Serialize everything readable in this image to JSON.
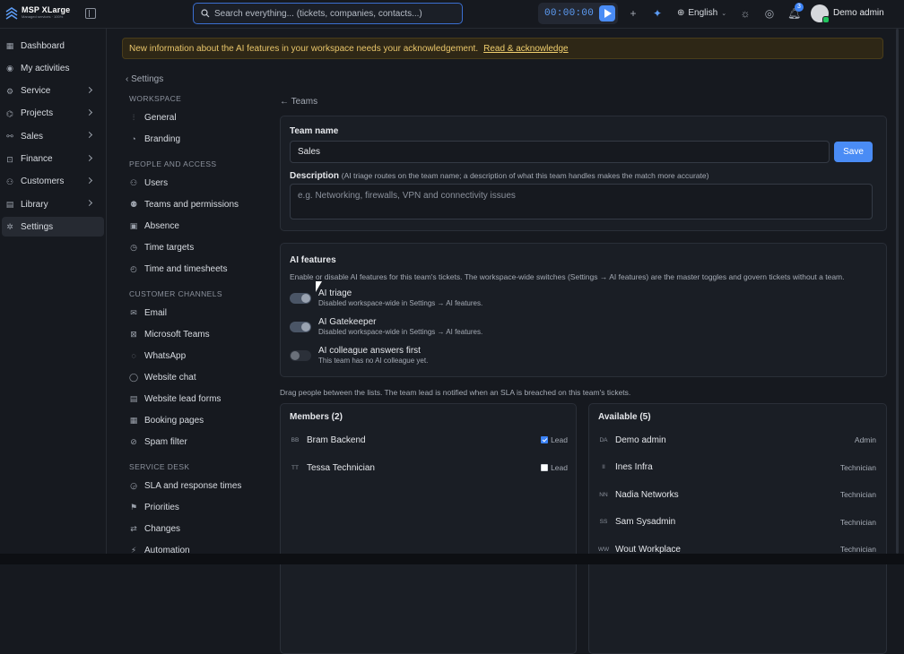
{
  "app": {
    "name": "MSP XLarge",
    "tagline": "Managed services · 100%"
  },
  "search": {
    "placeholder": "Search everything... (tickets, companies, contacts...)"
  },
  "timer": {
    "value": "00:00:00"
  },
  "topbar": {
    "language": "English",
    "notifications_count": "3",
    "user": "Demo admin"
  },
  "sidebar": {
    "items": [
      {
        "label": "Dashboard",
        "icon": "dashboard-icon",
        "chevron": false,
        "active": false
      },
      {
        "label": "My activities",
        "icon": "activities-icon",
        "chevron": false,
        "active": false
      },
      {
        "label": "Service",
        "icon": "service-icon",
        "chevron": true,
        "active": false
      },
      {
        "label": "Projects",
        "icon": "projects-icon",
        "chevron": true,
        "active": false
      },
      {
        "label": "Sales",
        "icon": "sales-icon",
        "chevron": true,
        "active": false
      },
      {
        "label": "Finance",
        "icon": "finance-icon",
        "chevron": true,
        "active": false
      },
      {
        "label": "Customers",
        "icon": "customers-icon",
        "chevron": true,
        "active": false
      },
      {
        "label": "Library",
        "icon": "library-icon",
        "chevron": true,
        "active": false
      },
      {
        "label": "Settings",
        "icon": "settings-icon",
        "chevron": false,
        "active": true
      }
    ]
  },
  "banner": {
    "text": "New information about the AI features in your workspace needs your acknowledgement.",
    "link": "Read & acknowledge"
  },
  "settings_nav": {
    "back": "Settings",
    "sections": [
      {
        "heading": "WORKSPACE",
        "items": [
          {
            "label": "General",
            "icon": "sliders-icon"
          },
          {
            "label": "Branding",
            "icon": "palette-icon"
          }
        ]
      },
      {
        "heading": "PEOPLE AND ACCESS",
        "items": [
          {
            "label": "Users",
            "icon": "users-icon"
          },
          {
            "label": "Teams and permissions",
            "icon": "teams-icon"
          },
          {
            "label": "Absence",
            "icon": "calendar-icon"
          },
          {
            "label": "Time targets",
            "icon": "clock-icon"
          },
          {
            "label": "Time and timesheets",
            "icon": "timesheet-icon"
          }
        ]
      },
      {
        "heading": "CUSTOMER CHANNELS",
        "items": [
          {
            "label": "Email",
            "icon": "mail-icon"
          },
          {
            "label": "Microsoft Teams",
            "icon": "ms-teams-icon"
          },
          {
            "label": "WhatsApp",
            "icon": "whatsapp-icon"
          },
          {
            "label": "Website chat",
            "icon": "chat-icon"
          },
          {
            "label": "Website lead forms",
            "icon": "form-icon"
          },
          {
            "label": "Booking pages",
            "icon": "booking-icon"
          },
          {
            "label": "Spam filter",
            "icon": "spam-icon"
          }
        ]
      },
      {
        "heading": "SERVICE DESK",
        "items": [
          {
            "label": "SLA and response times",
            "icon": "sla-icon"
          },
          {
            "label": "Priorities",
            "icon": "flag-icon"
          },
          {
            "label": "Changes",
            "icon": "changes-icon"
          },
          {
            "label": "Automation",
            "icon": "automation-icon"
          }
        ]
      }
    ]
  },
  "main": {
    "breadcrumb": "Teams",
    "team_name_label": "Team name",
    "team_name_value": "Sales",
    "save_label": "Save",
    "description_label": "Description",
    "description_hint": "(AI triage routes on the team name; a description of what this team handles makes the match more accurate)",
    "description_placeholder": "e.g. Networking, firewalls, VPN and connectivity issues",
    "ai_title": "AI features",
    "ai_intro": "Enable or disable AI features for this team's tickets. The workspace-wide switches (Settings → AI features) are the master toggles and govern tickets without a team.",
    "ai_features": [
      {
        "title": "AI triage",
        "sub": "Disabled workspace-wide in Settings → AI features.",
        "on": true
      },
      {
        "title": "AI Gatekeeper",
        "sub": "Disabled workspace-wide in Settings → AI features.",
        "on": true
      },
      {
        "title": "AI colleague answers first",
        "sub": "This team has no AI colleague yet.",
        "on": false
      }
    ],
    "drag_hint": "Drag people between the lists. The team lead is notified when an SLA is breached on this team's tickets.",
    "members_title": "Members (2)",
    "members": [
      {
        "initials": "BB",
        "name": "Bram Backend",
        "lead": true,
        "lead_label": "Lead"
      },
      {
        "initials": "TT",
        "name": "Tessa Technician",
        "lead": false,
        "lead_label": "Lead"
      }
    ],
    "available_title": "Available (5)",
    "available": [
      {
        "initials": "DA",
        "name": "Demo admin",
        "role": "Admin"
      },
      {
        "initials": "II",
        "name": "Ines Infra",
        "role": "Technician"
      },
      {
        "initials": "NN",
        "name": "Nadia Networks",
        "role": "Technician"
      },
      {
        "initials": "SS",
        "name": "Sam Sysadmin",
        "role": "Technician"
      },
      {
        "initials": "WW",
        "name": "Wout Workplace",
        "role": "Technician"
      }
    ]
  },
  "colors": {
    "accent": "#4a8cf5",
    "banner_text": "#e8c56a",
    "background": "#16191f"
  }
}
